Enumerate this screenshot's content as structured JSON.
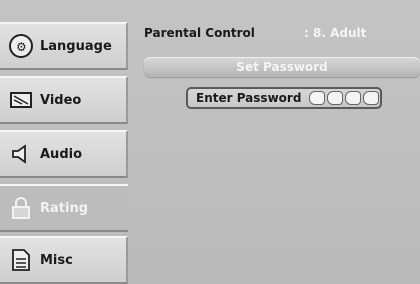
{
  "sidebar": {
    "items": [
      {
        "label": "Language",
        "icon": "language-icon"
      },
      {
        "label": "Video",
        "icon": "video-icon"
      },
      {
        "label": "Audio",
        "icon": "speaker-icon"
      },
      {
        "label": "Rating",
        "icon": "lock-icon",
        "active": true
      },
      {
        "label": "Misc",
        "icon": "document-icon"
      }
    ]
  },
  "parental_control": {
    "label": "Parental Control",
    "value": ": 8. Adult"
  },
  "set_password": {
    "title": "Set Password",
    "prompt": "Enter Password",
    "slots": 4
  },
  "colors": {
    "background": "#bdbdbd",
    "active_text": "#f5f5f5"
  }
}
